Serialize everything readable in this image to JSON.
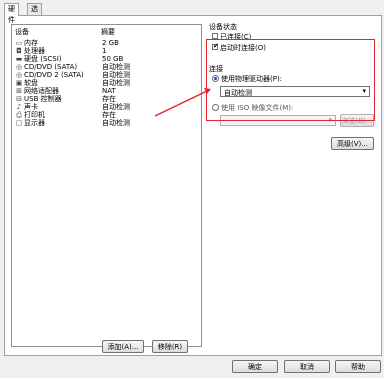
{
  "tabs": [
    "硬件",
    "选项"
  ],
  "device_list": {
    "header_device": "设备",
    "header_summary": "摘要",
    "rows": [
      {
        "icon": "memory-icon",
        "glyph": "▭",
        "name": "内存",
        "summary": "2 GB"
      },
      {
        "icon": "cpu-icon",
        "glyph": "◘",
        "name": "处理器",
        "summary": "1"
      },
      {
        "icon": "disk-icon",
        "glyph": "▬",
        "name": "硬盘 (SCSI)",
        "summary": "50 GB"
      },
      {
        "icon": "cd-icon",
        "glyph": "◎",
        "name": "CD/DVD (SATA)",
        "summary": "自动检测"
      },
      {
        "icon": "cd-icon",
        "glyph": "◎",
        "name": "CD/DVD 2 (SATA)",
        "summary": "自动检测"
      },
      {
        "icon": "floppy-icon",
        "glyph": "▣",
        "name": "软盘",
        "summary": "自动检测"
      },
      {
        "icon": "network-icon",
        "glyph": "⊞",
        "name": "网络适配器",
        "summary": "NAT"
      },
      {
        "icon": "usb-icon",
        "glyph": "⊟",
        "name": "USB 控制器",
        "summary": "存在"
      },
      {
        "icon": "sound-icon",
        "glyph": "♪",
        "name": "声卡",
        "summary": "自动检测"
      },
      {
        "icon": "printer-icon",
        "glyph": "⎙",
        "name": "打印机",
        "summary": "存在"
      },
      {
        "icon": "display-icon",
        "glyph": "▢",
        "name": "显示器",
        "summary": "自动检测"
      }
    ]
  },
  "buttons": {
    "add": "添加(A)...",
    "remove": "移除(R)",
    "advanced": "高级(V)...",
    "browse": "浏览(B)...",
    "ok": "确定",
    "cancel": "取消",
    "help": "帮助"
  },
  "device_status": {
    "title": "设备状态",
    "connected": "已连接(C)",
    "connect_on_start": "启动时连接(O)"
  },
  "connection": {
    "title": "连接",
    "physical_drive": "使用物理驱动器(P):",
    "physical_drive_value": "自动检测",
    "iso_image": "使用 ISO 映像文件(M):"
  },
  "colors": {
    "highlight": "#e8232a"
  }
}
